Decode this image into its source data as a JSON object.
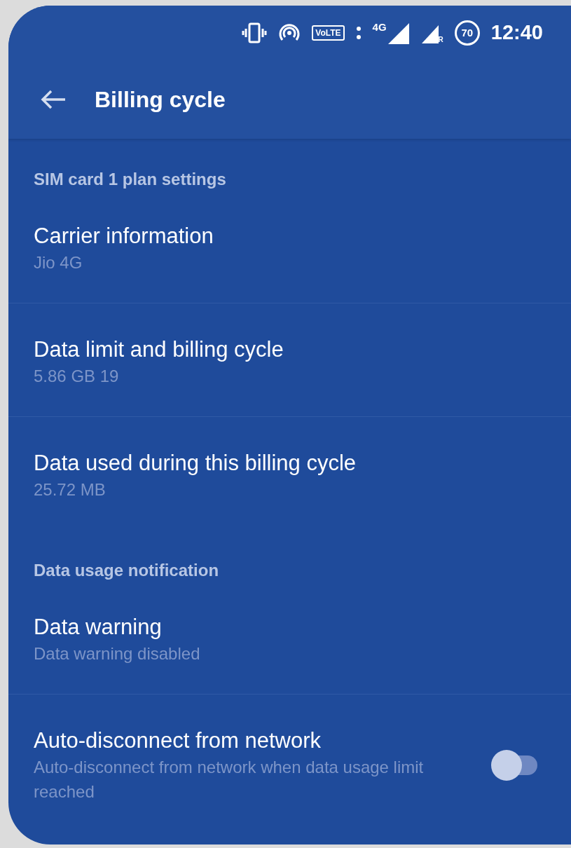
{
  "status_bar": {
    "network_badge": "VoLTE",
    "network_type": "4G",
    "roaming": "R",
    "battery": "70",
    "time": "12:40"
  },
  "header": {
    "title": "Billing cycle"
  },
  "sections": [
    {
      "header": "SIM card 1 plan settings",
      "items": [
        {
          "kind": "item",
          "title": "Carrier information",
          "subtitle": "Jio 4G"
        },
        {
          "kind": "item",
          "title": "Data limit and billing cycle",
          "subtitle": "5.86 GB 19"
        },
        {
          "kind": "item",
          "title": "Data used during this billing cycle",
          "subtitle": "25.72 MB"
        }
      ]
    },
    {
      "header": "Data usage notification",
      "items": [
        {
          "kind": "item",
          "title": "Data warning",
          "subtitle": "Data warning disabled"
        },
        {
          "kind": "toggle",
          "title": "Auto-disconnect from network",
          "subtitle": "Auto-disconnect from network when data usage limit reached",
          "on": false
        }
      ]
    }
  ]
}
